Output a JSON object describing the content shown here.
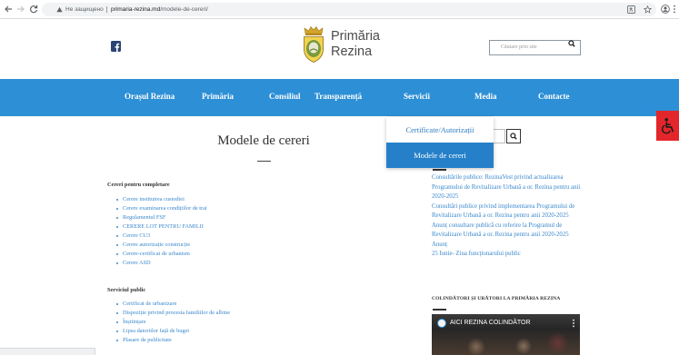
{
  "browser": {
    "icons": {
      "back": "arrow-left-icon",
      "forward": "arrow-right-icon",
      "reload": "reload-icon",
      "security": "warning-icon",
      "translate": "translate-icon",
      "bookmark": "star-icon",
      "profile": "profile-icon",
      "menu": "kebab-menu-icon"
    },
    "security_label": "Не защищено",
    "url_domain": "primaria-rezina.md",
    "url_path": "/modele-de-cereri/"
  },
  "header": {
    "icons": {
      "social": "facebook-icon",
      "logo": "coat-of-arms-logo",
      "search": "search-icon"
    },
    "site_name_line1": "Primăria",
    "site_name_line2": "Rezina",
    "search_placeholder": "Căutare prin site"
  },
  "nav": {
    "items": [
      "Orașul Rezina",
      "Primăria",
      "Consiliul",
      "Transparență",
      "Servicii",
      "Media",
      "Contacte"
    ],
    "dropdown_items": [
      "Certificate/Autorizații",
      "Modele de cereri"
    ],
    "dropdown_active_index": 1
  },
  "accessibility": {
    "icon": "wheelchair-icon"
  },
  "main": {
    "title": "Modele de cereri",
    "sections": [
      {
        "heading": "Cereri pentru completare",
        "items": [
          "Cerere instituirea custodiei",
          "Cerere examinarea condițiilor de trai",
          "Regulamentul FSF",
          "CERERE LOT PENTRU FAMILII",
          "Cerere CU3",
          "Cerere autorizație construcție",
          "Cerere-certificat de urbanism",
          "Cerere ASD"
        ]
      },
      {
        "heading": "Serviciul public",
        "items": [
          "Certificat de urbanizare",
          "Dispoziție privind procesia familiilor de albine",
          "Înștiințare",
          "Lipsa datoriilor față de buget",
          "Plasare de publicitate"
        ]
      }
    ]
  },
  "sidebar": {
    "search_icon": "search-icon",
    "links": [
      "Consultările publice: RezinaVest privind actualizarea Programului de Revitalizare Urbană a or. Rezina pentru anii 2020-2025",
      "Consultări publice privind implementarea Programului de Revitalizare Urbană a or. Rezina pentru anii 2020-2025",
      "Anunț consultare publică cu referire la Programul de Revitalizare Urbană a or. Rezina pentru anii 2020-2025",
      "Anunț",
      "25 Iunie- Ziua funcționarului public"
    ],
    "video_section_heading": "COLINDĂTORI ȘI URĂTORI LA PRIMĂRIA REZINA",
    "video_title": "AICI REZINA COLINDĂTOR"
  },
  "colors": {
    "nav_bg": "#2d8fd5",
    "link": "#3a88cc",
    "dropdown_active": "#2580c9",
    "accessibility_bg": "#e3262b"
  }
}
